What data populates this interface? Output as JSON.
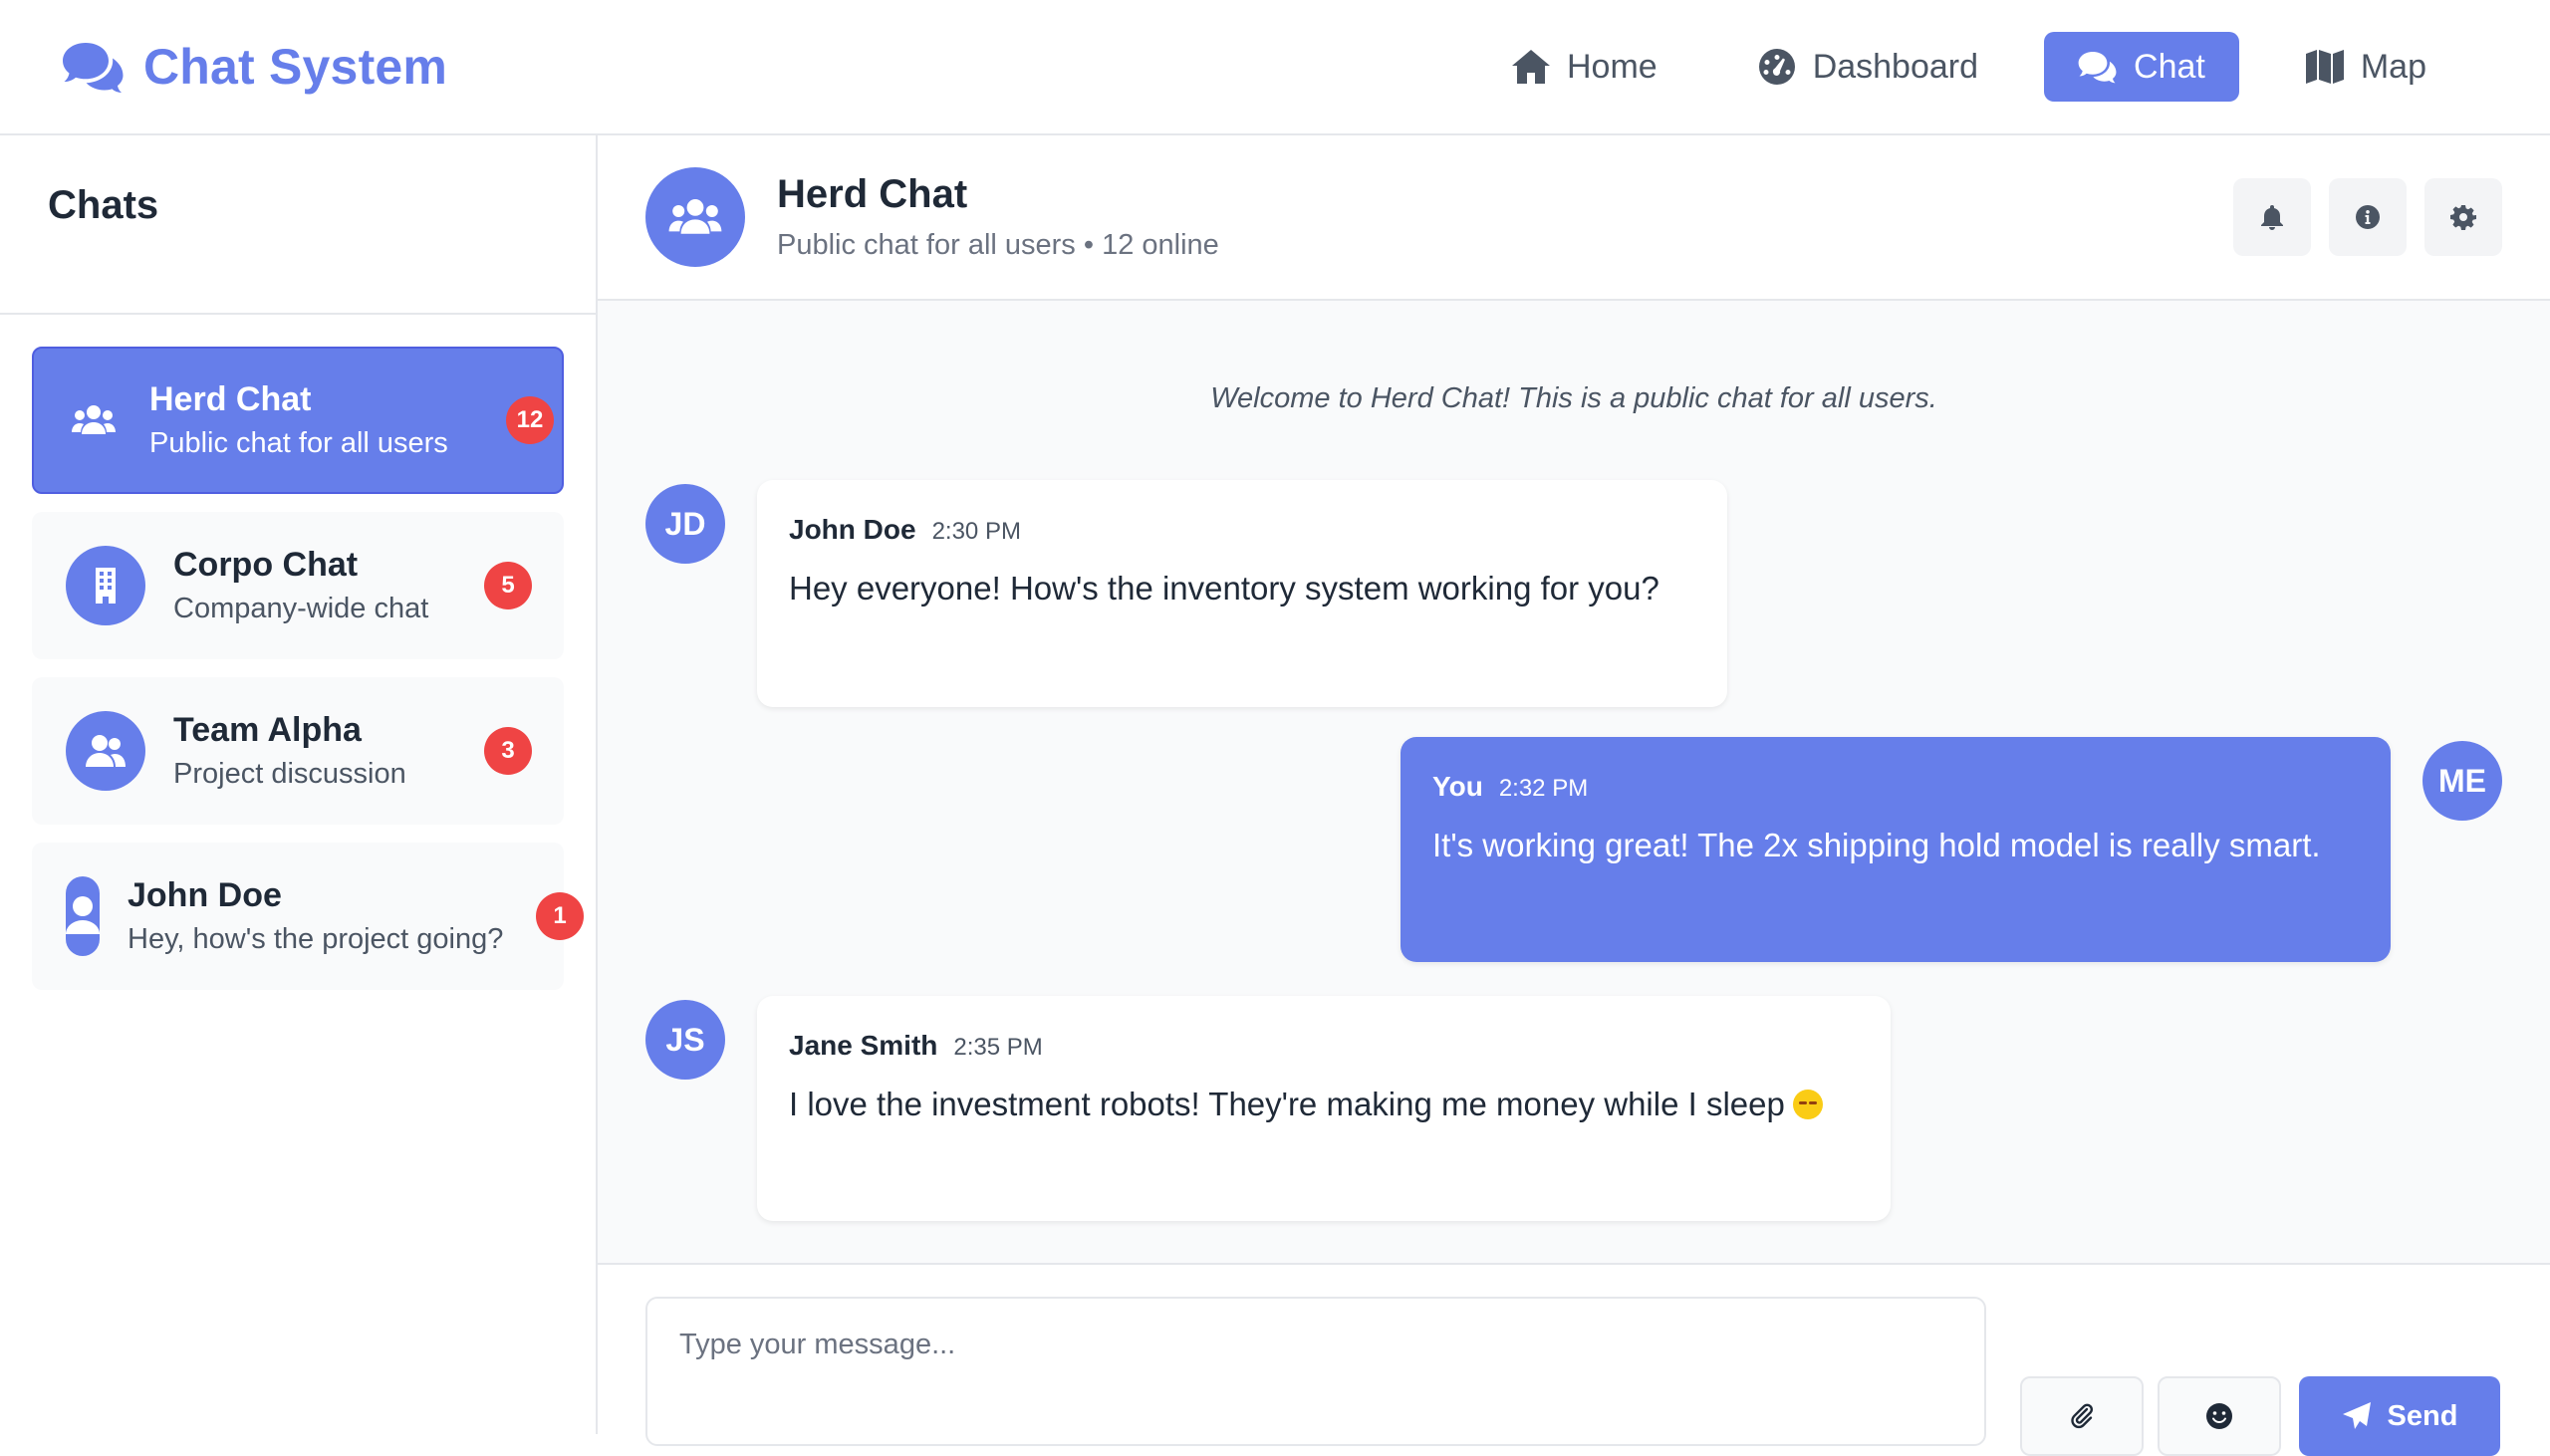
{
  "app": {
    "title": "Chat System"
  },
  "nav": {
    "items": [
      {
        "label": "Home",
        "icon": "home-icon"
      },
      {
        "label": "Dashboard",
        "icon": "dashboard-icon"
      },
      {
        "label": "Chat",
        "icon": "chat-icon",
        "active": true
      },
      {
        "label": "Map",
        "icon": "map-icon"
      }
    ]
  },
  "sidebar": {
    "title": "Chats",
    "chats": [
      {
        "name": "Herd Chat",
        "subtitle": "Public chat for all users",
        "badge": "12",
        "icon": "users-icon",
        "active": true
      },
      {
        "name": "Corpo Chat",
        "subtitle": "Company-wide chat",
        "badge": "5",
        "icon": "building-icon"
      },
      {
        "name": "Team Alpha",
        "subtitle": "Project discussion",
        "badge": "3",
        "icon": "user-group-icon"
      },
      {
        "name": "John Doe",
        "subtitle": "Hey, how's the project going?",
        "badge": "1",
        "icon": "user-icon"
      }
    ]
  },
  "chat": {
    "title": "Herd Chat",
    "subtitle": "Public chat for all users • 12 online",
    "actions": [
      "bell-icon",
      "info-icon",
      "settings-icon"
    ],
    "system_message": "Welcome to Herd Chat! This is a public chat for all users.",
    "messages": [
      {
        "initials": "JD",
        "author": "John Doe",
        "time": "2:30 PM",
        "text": "Hey everyone! How's the inventory system working for you?",
        "own": false
      },
      {
        "initials": "ME",
        "author": "You",
        "time": "2:32 PM",
        "text": "It's working great! The 2x shipping hold model is really smart.",
        "own": true
      },
      {
        "initials": "JS",
        "author": "Jane Smith",
        "time": "2:35 PM",
        "text": "I love the investment robots! They're making me money while I sleep",
        "emoji": "sleeping-face-emoji",
        "own": false
      }
    ]
  },
  "composer": {
    "placeholder": "Type your message...",
    "value": "",
    "send_label": "Send"
  },
  "colors": {
    "accent": "#667eea",
    "badge": "#ef4444",
    "background": "#f9fafb"
  }
}
